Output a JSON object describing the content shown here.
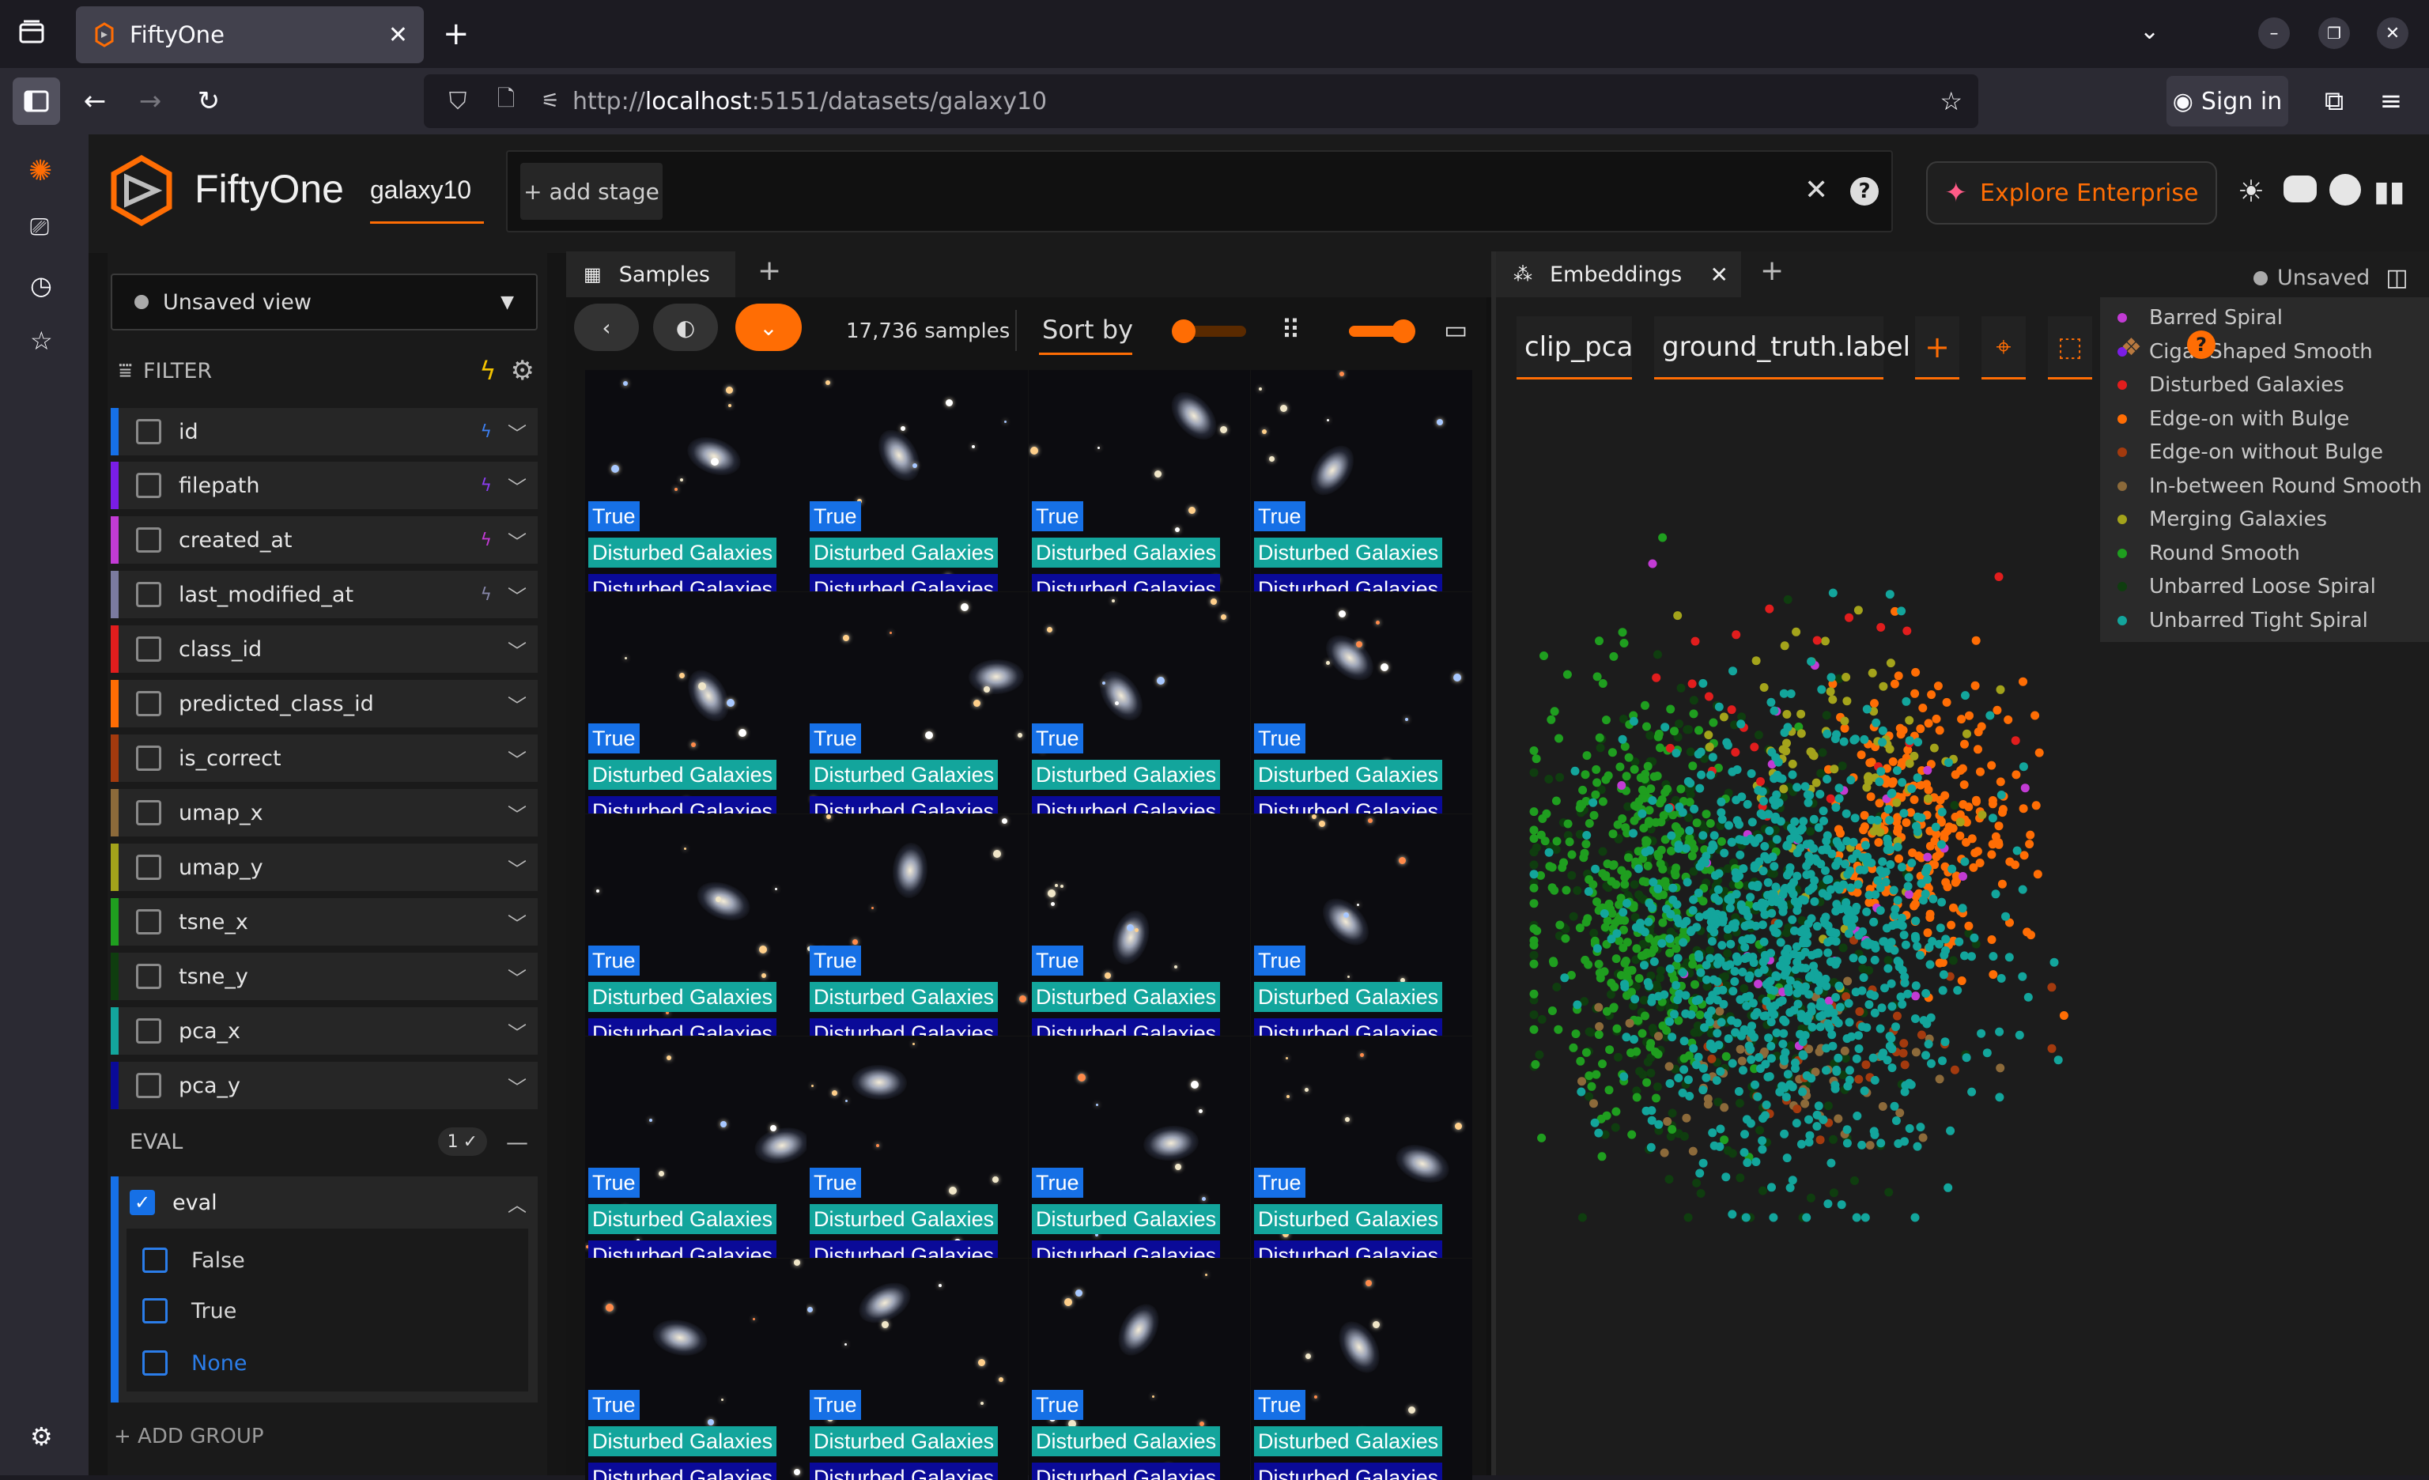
{
  "browser": {
    "tab_title": "FiftyOne",
    "url_prefix": "http://",
    "url_host": "localhost",
    "url_rest": ":5151/datasets/galaxy10",
    "sign_in": "Sign in"
  },
  "app": {
    "name": "FiftyOne",
    "dataset": "galaxy10",
    "add_stage": "+ add stage",
    "explore_enterprise": "Explore Enterprise"
  },
  "sidebar": {
    "view": "Unsaved view",
    "filter_label": "FILTER",
    "fields": [
      {
        "label": "id",
        "color": "#1670e6",
        "bolt": true,
        "bolt_color": "#3d7ff0"
      },
      {
        "label": "filepath",
        "color": "#7a1de6",
        "bolt": true,
        "bolt_color": "#8a3df0"
      },
      {
        "label": "created_at",
        "color": "#c23bd4",
        "bolt": true,
        "bolt_color": "#c23bd4"
      },
      {
        "label": "last_modified_at",
        "color": "#7b7ba0",
        "bolt": true,
        "bolt_color": "#8686a8"
      },
      {
        "label": "class_id",
        "color": "#e11d1d",
        "bolt": false
      },
      {
        "label": "predicted_class_id",
        "color": "#ff6d04",
        "bolt": false
      },
      {
        "label": "is_correct",
        "color": "#a33a0e",
        "bolt": false
      },
      {
        "label": "umap_x",
        "color": "#8c6a3a",
        "bolt": false
      },
      {
        "label": "umap_y",
        "color": "#a3a31b",
        "bolt": false
      },
      {
        "label": "tsne_x",
        "color": "#1f9e1f",
        "bolt": false
      },
      {
        "label": "tsne_y",
        "color": "#0f3d0f",
        "bolt": false
      },
      {
        "label": "pca_x",
        "color": "#13a59c",
        "bolt": false
      },
      {
        "label": "pca_y",
        "color": "#0a0a98",
        "bolt": false
      }
    ],
    "group_name": "EVAL",
    "group_count": "1",
    "eval_field": "eval",
    "eval_options": [
      "False",
      "True",
      "None"
    ],
    "add_group": "+ ADD GROUP"
  },
  "samples": {
    "tab_label": "Samples",
    "count": "17,736 samples",
    "sort_by": "Sort by",
    "tags": {
      "eval": "True",
      "ground_truth": "Disturbed Galaxies",
      "prediction": "Disturbed Galaxies"
    },
    "rows": 5,
    "cols": 4
  },
  "embeddings": {
    "tab_label": "Embeddings",
    "brain_key": "clip_pca",
    "color_by": "ground_truth.label",
    "unsaved": "Unsaved",
    "legend": [
      {
        "label": "Barred Spiral",
        "color": "#c23bd4"
      },
      {
        "label": "Cigar-Shaped Smooth",
        "color": "#7a1de6"
      },
      {
        "label": "Disturbed Galaxies",
        "color": "#e11d1d"
      },
      {
        "label": "Edge-on with Bulge",
        "color": "#ff6d04"
      },
      {
        "label": "Edge-on without Bulge",
        "color": "#a33a0e"
      },
      {
        "label": "In-between Round Smooth",
        "color": "#8c6a3a"
      },
      {
        "label": "Merging Galaxies",
        "color": "#a3a31b"
      },
      {
        "label": "Round Smooth",
        "color": "#1f9e1f"
      },
      {
        "label": "Unbarred Loose Spiral",
        "color": "#0f3d0f"
      },
      {
        "label": "Unbarred Tight Spiral",
        "color": "#13a59c"
      }
    ]
  }
}
